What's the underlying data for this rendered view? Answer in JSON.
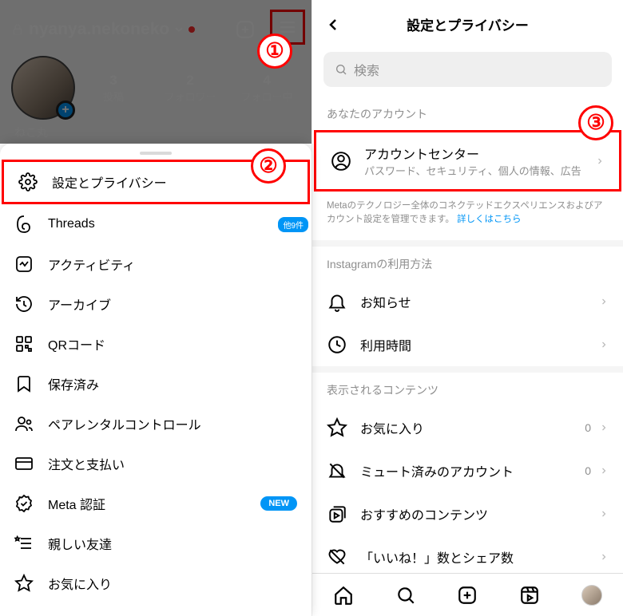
{
  "callouts": {
    "c1": "①",
    "c2": "②",
    "c3": "③"
  },
  "profile": {
    "username": "nyanya.nekoneko",
    "displayName": "ねこ丸",
    "stats": {
      "posts": {
        "n": "3",
        "label": "投稿"
      },
      "followers": {
        "n": "2",
        "label": "フォロワー"
      },
      "following": {
        "n": "4",
        "label": "フォロー中"
      }
    }
  },
  "sheet": {
    "items": [
      {
        "label": "設定とプライバシー"
      },
      {
        "label": "Threads",
        "badge": "他9件"
      },
      {
        "label": "アクティビティ"
      },
      {
        "label": "アーカイブ"
      },
      {
        "label": "QRコード"
      },
      {
        "label": "保存済み"
      },
      {
        "label": "ペアレンタルコントロール"
      },
      {
        "label": "注文と支払い"
      },
      {
        "label": "Meta 認証",
        "badge": "NEW"
      },
      {
        "label": "親しい友達"
      },
      {
        "label": "お気に入り"
      }
    ]
  },
  "settings": {
    "title": "設定とプライバシー",
    "searchPlaceholder": "検索",
    "accountSection": "あなたのアカウント",
    "accountCenter": {
      "title": "アカウントセンター",
      "sub": "パスワード、セキュリティ、個人の情報、広告"
    },
    "metaNote": "Metaのテクノロジー全体のコネクテッドエクスペリエンスおよびアカウント設定を管理できます。",
    "metaLink": "詳しくはこちら",
    "usageSection": "Instagramの利用方法",
    "usage": [
      {
        "label": "お知らせ"
      },
      {
        "label": "利用時間"
      }
    ],
    "contentSection": "表示されるコンテンツ",
    "content": [
      {
        "label": "お気に入り",
        "count": "0"
      },
      {
        "label": "ミュート済みのアカウント",
        "count": "0"
      },
      {
        "label": "おすすめのコンテンツ"
      },
      {
        "label": "「いいね！」数とシェア数"
      }
    ]
  }
}
